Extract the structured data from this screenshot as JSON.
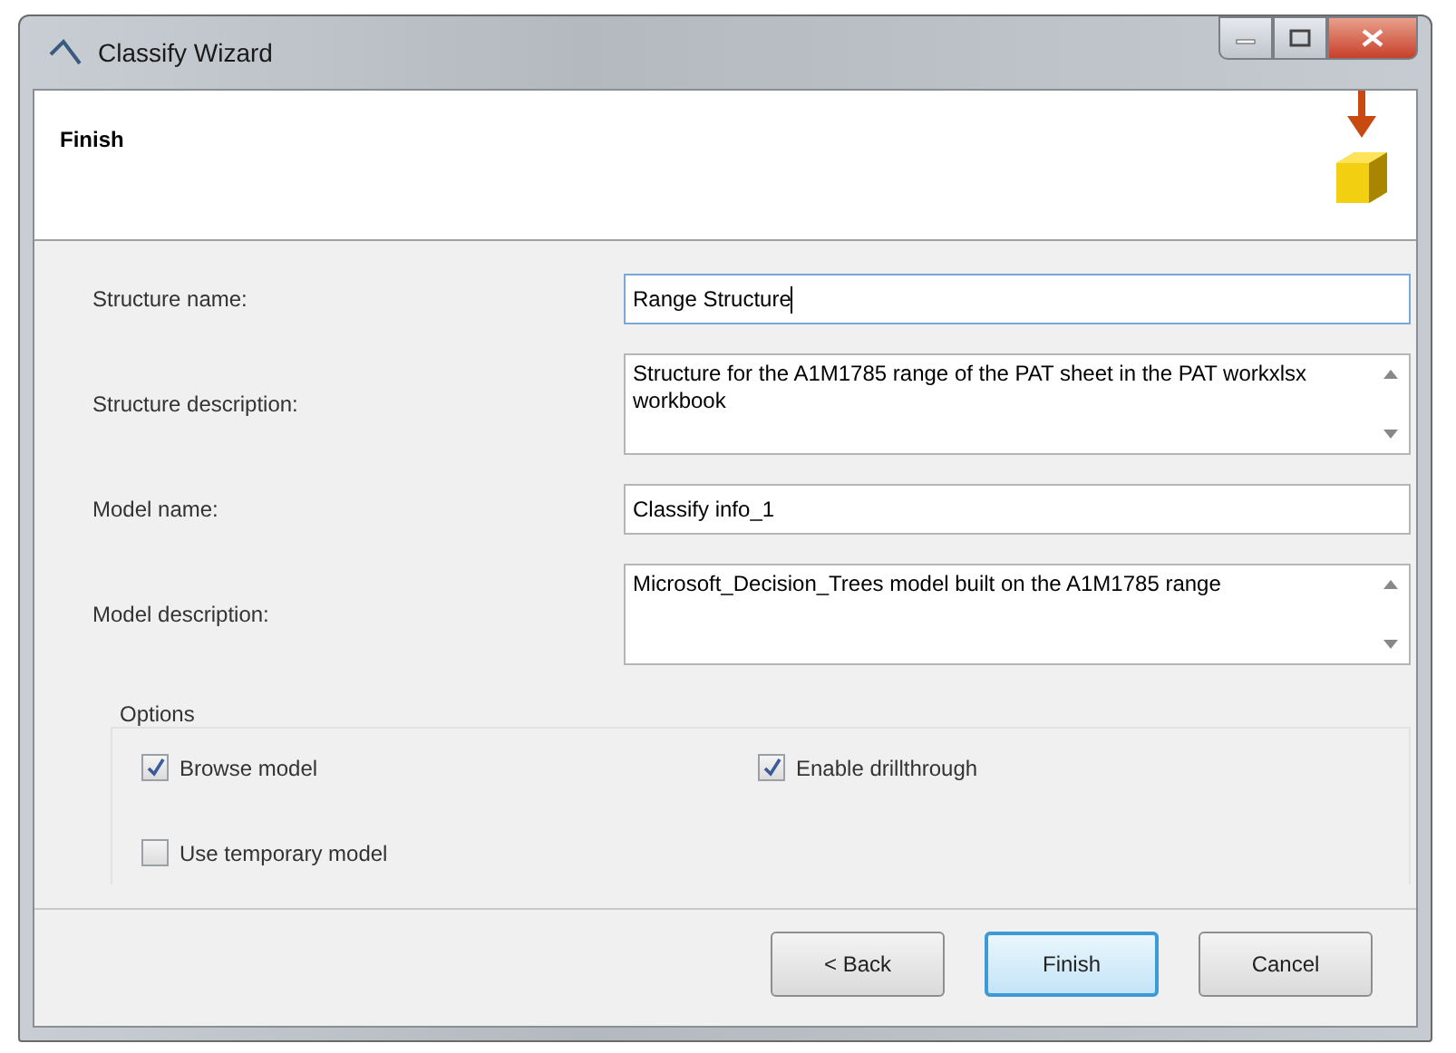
{
  "window": {
    "title": "Classify Wizard"
  },
  "header": {
    "title": "Finish"
  },
  "fields": [
    {
      "label": "Structure name:",
      "kind": "text",
      "value": "Range Structure",
      "focused": true
    },
    {
      "label": "Structure description:",
      "kind": "multiline",
      "value": "Structure for the A1M1785 range of the PAT sheet in the PAT workxlsx workbook",
      "focused": false
    },
    {
      "label": "Model name:",
      "kind": "text",
      "value": "Classify info_1",
      "focused": false
    },
    {
      "label": "Model description:",
      "kind": "multiline",
      "value": "Microsoft_Decision_Trees model built on the A1M1785 range",
      "focused": false
    }
  ],
  "options": {
    "title": "Options",
    "checkboxes": [
      {
        "label": "Browse model",
        "checked": true
      },
      {
        "label": "Enable drillthrough",
        "checked": true
      },
      {
        "label": "Use temporary model",
        "checked": false
      }
    ]
  },
  "buttons": [
    {
      "label": "< Back",
      "default": false
    },
    {
      "label": "Finish",
      "default": true
    },
    {
      "label": "Cancel",
      "default": false
    }
  ]
}
